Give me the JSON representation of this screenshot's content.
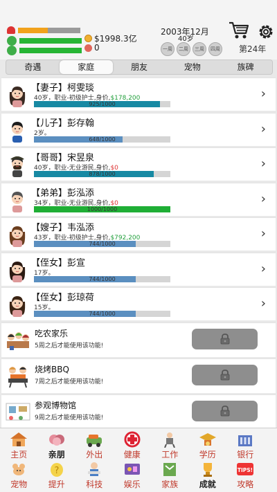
{
  "status": {
    "health_pct": 0.48,
    "mood_pct": 1.0,
    "energy_pct": 1.0,
    "money": "$1998.3亿",
    "gems": "0",
    "colors": {
      "health": "#f1a21c",
      "mood": "#27b534",
      "energy": "#27b534"
    }
  },
  "date": {
    "text": "2003年12月",
    "age": "40岁",
    "week_labels": [
      "一周",
      "二周",
      "三周",
      "四周"
    ],
    "year_label": "第24年"
  },
  "tabs": [
    "奇遇",
    "家庭",
    "朋友",
    "宠物",
    "族碑"
  ],
  "active_tab": "家庭",
  "members": [
    {
      "name": "【妻子】柯雯琰",
      "info": "40岁，职业-初级护士,身价,",
      "money": "$178,200",
      "bar": "925/1000",
      "fill": 0.925,
      "color": "#1789a3"
    },
    {
      "name": "【儿子】彭存翰",
      "info": "2岁。",
      "money": "",
      "bar": "648/1000",
      "fill": 0.648,
      "color": "#5b8fc0"
    },
    {
      "name": "【哥哥】宋昱泉",
      "info": "40岁，职业-无业游民,身价,",
      "money": "$0",
      "bar": "878/1000",
      "fill": 0.878,
      "color": "#1789a3"
    },
    {
      "name": "【弟弟】彭泓添",
      "info": "34岁，职业-无业游民,身价,",
      "money": "$0",
      "bar": "1000/1000",
      "fill": 1.0,
      "color": "#1fae35"
    },
    {
      "name": "【嫂子】韦泓添",
      "info": "43岁，职业-初级护士,身价,",
      "money": "$792,200",
      "bar": "744/1000",
      "fill": 0.744,
      "color": "#5b8fc0"
    },
    {
      "name": "【侄女】彭宣",
      "info": "17岁。",
      "money": "",
      "bar": "744/1000",
      "fill": 0.744,
      "color": "#5b8fc0"
    },
    {
      "name": "【侄女】彭琼荷",
      "info": "15岁。",
      "money": "",
      "bar": "744/1000",
      "fill": 0.744,
      "color": "#5b8fc0"
    }
  ],
  "activities": [
    {
      "title": "吃农家乐",
      "desc": "5周之后才能使用该功能!"
    },
    {
      "title": "烧烤BBQ",
      "desc": "7周之后才能使用该功能!"
    },
    {
      "title": "参观博物馆",
      "desc": "9周之后才能使用该功能!"
    }
  ],
  "nav_top": [
    "主页",
    "亲朋",
    "外出",
    "健康",
    "工作",
    "学历",
    "银行"
  ],
  "nav_bottom": [
    "宠物",
    "提升",
    "科技",
    "娱乐",
    "家族",
    "成就",
    "攻略"
  ],
  "nav_bold": [
    "亲朋",
    "成就"
  ],
  "nav_icon_text": "TIPS!"
}
